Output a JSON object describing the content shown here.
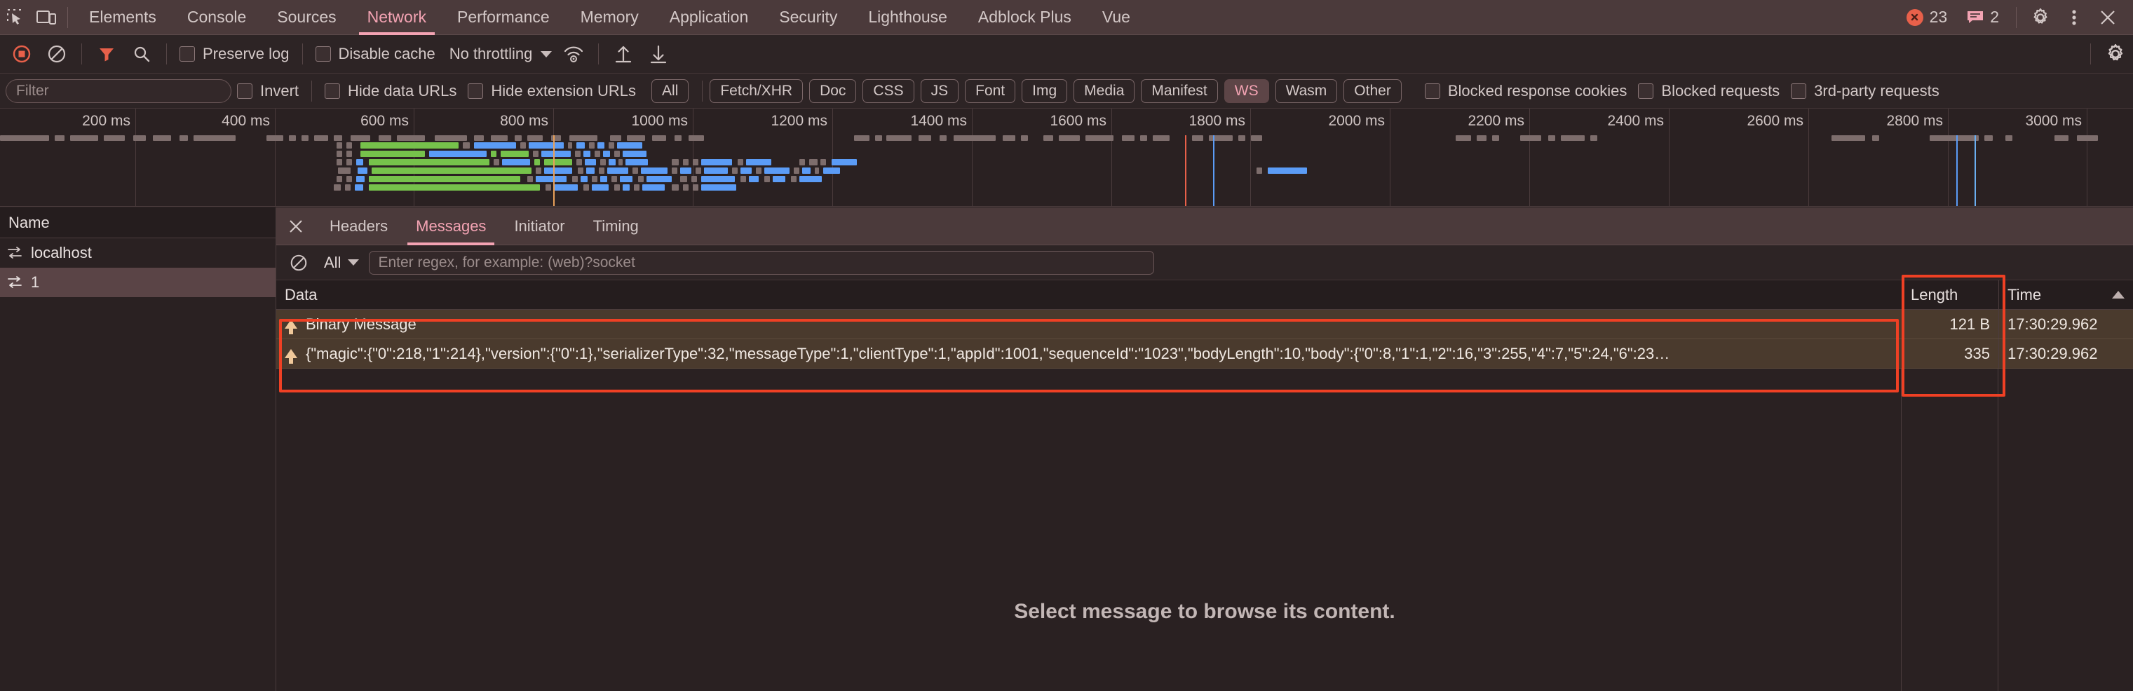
{
  "devtools": {
    "tabs": [
      {
        "label": "Elements",
        "active": false
      },
      {
        "label": "Console",
        "active": false
      },
      {
        "label": "Sources",
        "active": false
      },
      {
        "label": "Network",
        "active": true
      },
      {
        "label": "Performance",
        "active": false
      },
      {
        "label": "Memory",
        "active": false
      },
      {
        "label": "Application",
        "active": false
      },
      {
        "label": "Security",
        "active": false
      },
      {
        "label": "Lighthouse",
        "active": false
      },
      {
        "label": "Adblock Plus",
        "active": false
      },
      {
        "label": "Vue",
        "active": false
      }
    ],
    "error_count": "23",
    "warning_count": "2",
    "icons": {
      "inspect": "inspect-element-icon",
      "device": "device-toolbar-icon",
      "settings": "gear-icon",
      "more": "kebab-menu-icon",
      "close": "close-icon"
    }
  },
  "network_toolbar": {
    "record_label": "record-button",
    "clear_label": "clear-button",
    "filter_toggle_label": "filter-icon",
    "search_label": "search-icon",
    "preserve_log": "Preserve log",
    "disable_cache": "Disable cache",
    "throttling": "No throttling",
    "wifi_label": "network-conditions-icon",
    "import_label": "import-har-icon",
    "export_label": "export-har-icon",
    "settings_label": "network-settings-gear-icon"
  },
  "filter_row": {
    "placeholder": "Filter",
    "value": "",
    "invert": "Invert",
    "hide_data_urls": "Hide data URLs",
    "hide_extension_urls": "Hide extension URLs",
    "types": [
      {
        "label": "All",
        "selected": false
      },
      {
        "label": "Fetch/XHR",
        "selected": false
      },
      {
        "label": "Doc",
        "selected": false
      },
      {
        "label": "CSS",
        "selected": false
      },
      {
        "label": "JS",
        "selected": false
      },
      {
        "label": "Font",
        "selected": false
      },
      {
        "label": "Img",
        "selected": false
      },
      {
        "label": "Media",
        "selected": false
      },
      {
        "label": "Manifest",
        "selected": false
      },
      {
        "label": "WS",
        "selected": true
      },
      {
        "label": "Wasm",
        "selected": false
      },
      {
        "label": "Other",
        "selected": false
      }
    ],
    "blocked_response_cookies": "Blocked response cookies",
    "blocked_requests": "Blocked requests",
    "third_party_requests": "3rd-party requests"
  },
  "overview": {
    "ticks": [
      "200 ms",
      "400 ms",
      "600 ms",
      "800 ms",
      "1000 ms",
      "1200 ms",
      "1400 ms",
      "1600 ms",
      "1800 ms",
      "2000 ms",
      "2200 ms",
      "2400 ms",
      "2600 ms",
      "2800 ms",
      "3000 ms"
    ]
  },
  "requests_panel": {
    "column_header": "Name",
    "rows": [
      {
        "name": "localhost",
        "selected": false
      },
      {
        "name": "1",
        "selected": true
      }
    ]
  },
  "detail_panel": {
    "tabs": [
      {
        "label": "Headers",
        "active": false
      },
      {
        "label": "Messages",
        "active": true
      },
      {
        "label": "Initiator",
        "active": false
      },
      {
        "label": "Timing",
        "active": false
      }
    ],
    "message_filter": {
      "type_selected": "All",
      "regex_placeholder": "Enter regex, for example: (web)?socket",
      "regex_value": ""
    },
    "table": {
      "columns": [
        "Data",
        "Length",
        "Time"
      ],
      "sort_column": "Time",
      "sort_direction": "ascending",
      "rows": [
        {
          "direction": "sent",
          "data": "Binary Message",
          "length": "121 B",
          "time": "17:30:29.962"
        },
        {
          "direction": "sent",
          "data": "{\"magic\":{\"0\":218,\"1\":214},\"version\":{\"0\":1},\"serializerType\":32,\"messageType\":1,\"clientType\":1,\"appId\":1001,\"sequenceId\":\"1023\",\"bodyLength\":10,\"body\":{\"0\":8,\"1\":1,\"2\":16,\"3\":255,\"4\":7,\"5\":24,\"6\":23…",
          "length": "335",
          "time": "17:30:29.962"
        }
      ]
    },
    "empty_state": "Select message to browse its content."
  },
  "colors": {
    "accent_pink": "#f3a3b3",
    "highlight_red": "#ef4024",
    "error_red": "#e8604a",
    "row_amber": "#4a3a2d",
    "selection": "#5a4446",
    "bar_green": "#76c24b",
    "bar_blue": "#5b9cf6"
  }
}
